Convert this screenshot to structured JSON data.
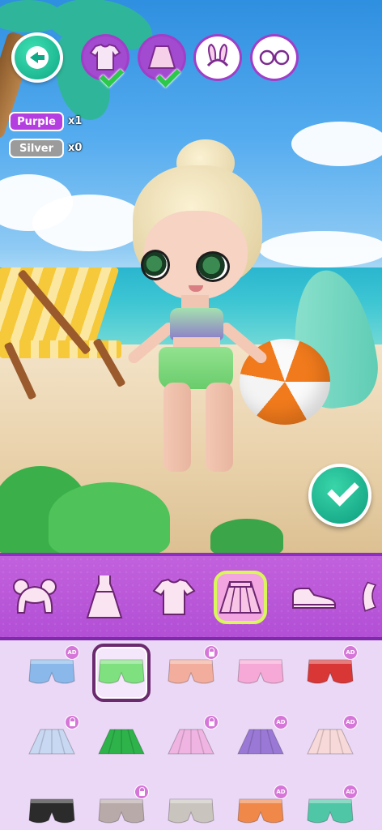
{
  "currency": {
    "purple": {
      "label": "Purple",
      "count": "x1",
      "color": "#b53ee0"
    },
    "silver": {
      "label": "Silver",
      "count": "x0",
      "color": "#9b9b9b"
    }
  },
  "top_categories": [
    {
      "name": "tops",
      "icon": "tshirt-icon",
      "completed": true
    },
    {
      "name": "skirts",
      "icon": "skirt-icon",
      "completed": true
    },
    {
      "name": "headband",
      "icon": "bunny-ears-headband-icon",
      "completed": false
    },
    {
      "name": "glasses",
      "icon": "glasses-icon",
      "completed": false
    }
  ],
  "category_bar": [
    {
      "icon": "hair-buns-icon",
      "active": false
    },
    {
      "icon": "dress-icon",
      "active": false
    },
    {
      "icon": "tshirt-icon",
      "active": false
    },
    {
      "icon": "skirt-icon",
      "active": true
    },
    {
      "icon": "sneaker-icon",
      "active": false
    },
    {
      "icon": "accessory-icon",
      "active": false
    }
  ],
  "items": [
    {
      "kind": "shorts",
      "color": "#8ab8ea",
      "badge": "AD",
      "selected": false
    },
    {
      "kind": "shorts",
      "color": "#7ee07e",
      "badge": "",
      "selected": true
    },
    {
      "kind": "shorts",
      "color": "#f2ad9d",
      "badge": "lock",
      "selected": false
    },
    {
      "kind": "shorts",
      "color": "#f6a8d6",
      "badge": "",
      "selected": false
    },
    {
      "kind": "shorts",
      "color": "#d93636",
      "badge": "AD",
      "selected": false
    },
    {
      "kind": "skirt",
      "color": "#c9d8f2",
      "badge": "lock",
      "selected": false
    },
    {
      "kind": "skirt",
      "color": "#2eb34b",
      "badge": "",
      "selected": false
    },
    {
      "kind": "skirt",
      "color": "#f0b4e2",
      "badge": "lock",
      "selected": false
    },
    {
      "kind": "skirt",
      "color": "#9a79d6",
      "badge": "AD",
      "selected": false
    },
    {
      "kind": "skirt",
      "color": "#f7d9d9",
      "badge": "AD",
      "selected": false
    },
    {
      "kind": "shorts",
      "color": "#2b2b2b",
      "badge": "",
      "selected": false
    },
    {
      "kind": "shorts",
      "color": "#b8aaa8",
      "badge": "lock",
      "selected": false
    },
    {
      "kind": "shorts",
      "color": "#c9c4bd",
      "badge": "",
      "selected": false
    },
    {
      "kind": "shorts",
      "color": "#f0884a",
      "badge": "AD",
      "selected": false
    },
    {
      "kind": "shorts",
      "color": "#4fc6a6",
      "badge": "AD",
      "selected": false
    }
  ],
  "accent": {
    "primary": "#b24fd6",
    "confirm": "#10a886"
  }
}
